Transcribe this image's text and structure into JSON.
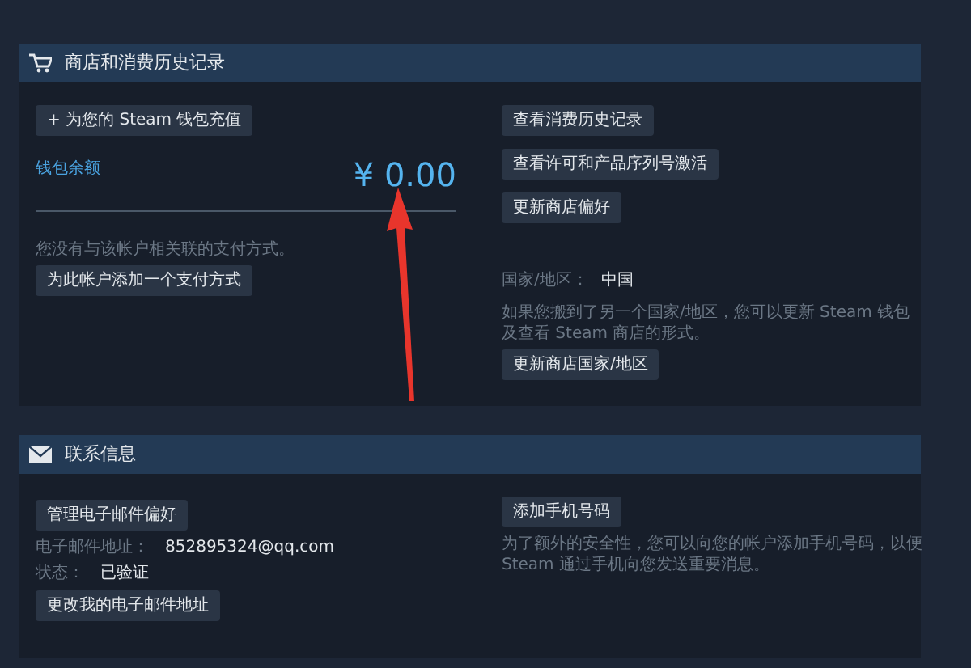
{
  "store_section": {
    "title": "商店和消费历史记录",
    "add_funds_button": "+ 为您的 Steam 钱包充值",
    "wallet_label": "钱包余额",
    "wallet_balance": "¥ 0.00",
    "no_payment_text": "您没有与该帐户相关联的支付方式。",
    "add_payment_button": "为此帐户添加一个支付方式",
    "right_buttons": [
      "查看消费历史记录",
      "查看许可和产品序列号激活",
      "更新商店偏好"
    ],
    "country_label": "国家/地区：",
    "country_value": "中国",
    "country_note": "如果您搬到了另一个国家/地区，您可以更新 Steam 钱包及查看 Steam 商店的形式。",
    "update_country_button": "更新商店国家/地区"
  },
  "contact_section": {
    "title": "联系信息",
    "manage_email_button": "管理电子邮件偏好",
    "fields": [
      {
        "label": "电子邮件地址：",
        "value": "852895324@qq.com"
      },
      {
        "label": "状态：",
        "value": "已验证"
      }
    ],
    "change_email_button": "更改我的电子邮件地址",
    "add_phone_button": "添加手机号码",
    "phone_note": "为了额外的安全性，您可以向您的帐户添加手机号码，以便 Steam 通过手机向您发送重要消息。"
  }
}
